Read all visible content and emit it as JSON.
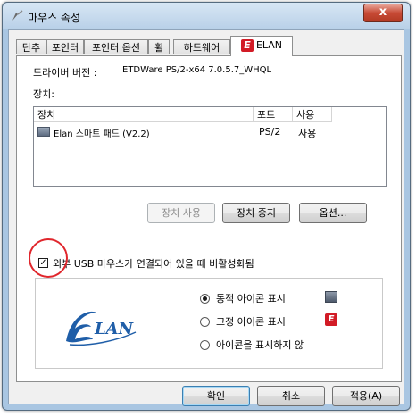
{
  "window": {
    "title": "마우스 속성",
    "close_label": "x"
  },
  "tabs": [
    {
      "label": "단추"
    },
    {
      "label": "포인터"
    },
    {
      "label": "포인터 옵션"
    },
    {
      "label": "휠"
    },
    {
      "label": "하드웨어"
    },
    {
      "label": "ELAN",
      "icon": "elan-logo-icon",
      "active": true
    }
  ],
  "driver": {
    "label": "드라이버 버전 :",
    "value": "ETDWare PS/2-x64 7.0.5.7_WHQL"
  },
  "devices": {
    "label": "장치:",
    "columns": [
      "장치",
      "포트",
      "사용"
    ],
    "rows": [
      {
        "name": "Elan 스마트 패드 (V2.2)",
        "port": "PS/2",
        "status": "사용",
        "icon": "touchpad-device-icon"
      }
    ]
  },
  "buttons": {
    "enable": "장치 사용",
    "disable": "장치 중지",
    "options": "옵션..."
  },
  "external_usb": {
    "label": "외부 USB 마우스가 연결되어 있을 때 비활성화됨",
    "checked": true
  },
  "icon_options": {
    "logo_text": "LAN",
    "items": [
      {
        "label": "동적 아이콘 표시",
        "selected": true,
        "icon": "monitor-icon"
      },
      {
        "label": "고정 아이콘 표시",
        "selected": false,
        "icon": "elan-logo-icon"
      },
      {
        "label": "아이콘을 표시하지 않",
        "selected": false
      }
    ]
  },
  "footer": {
    "ok": "확인",
    "cancel": "취소",
    "apply": "적용(A)"
  },
  "colors": {
    "annotation": "#e0262c",
    "elan_brand": "#d21b26",
    "logo_blue": "#1f5ea8"
  }
}
